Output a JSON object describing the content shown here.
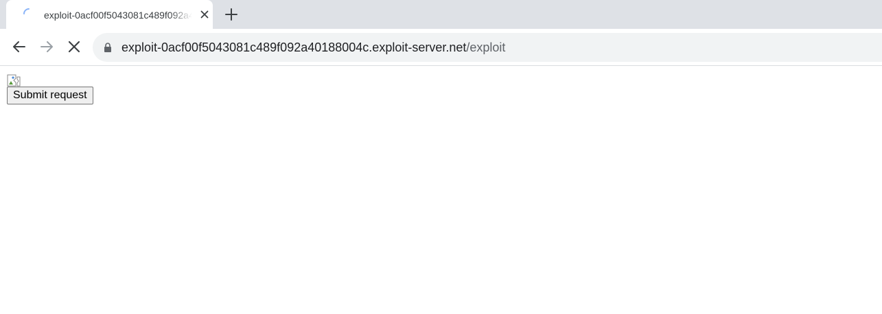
{
  "browser": {
    "tab": {
      "title": "exploit-0acf00f5043081c489f092a40188004c.exploit-server.net/exploit",
      "loading": true
    },
    "address_bar": {
      "host": "exploit-0acf00f5043081c489f092a40188004c.exploit-server.net",
      "path": "/exploit",
      "secure": true
    },
    "icons": {
      "spinner": "loading-spinner-icon",
      "close": "close-icon",
      "new_tab": "plus-icon",
      "back": "back-arrow-icon",
      "forward": "forward-arrow-icon",
      "stop": "stop-icon",
      "lock": "lock-icon"
    },
    "colors": {
      "tabstrip": "#dee1e6",
      "omnibox": "#f1f3f4",
      "spinner": "#1a73e8"
    }
  },
  "page": {
    "image": {
      "icon": "broken-image-icon"
    },
    "submit_button": {
      "label": "Submit request"
    }
  }
}
